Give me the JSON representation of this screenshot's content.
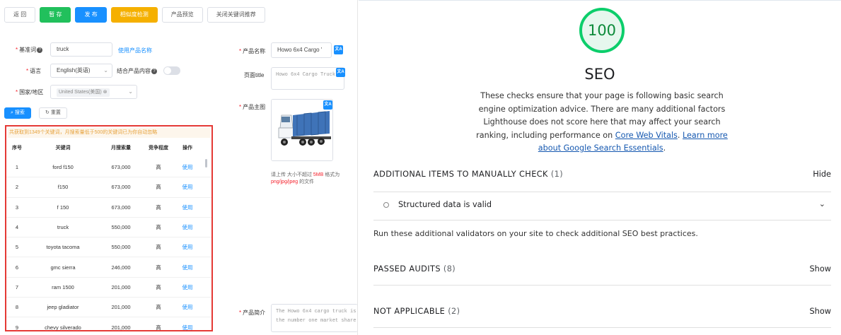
{
  "editor": {
    "toolbar": {
      "back": "返 回",
      "save_draft": "暂 存",
      "publish": "发 布",
      "similarity_check": "相似度检测",
      "preview": "产品预览",
      "close_keyword_recommend": "关闭关键词推荐"
    },
    "keyword_form": {
      "base_word_label": "基准词",
      "base_word_value": "truck",
      "use_product_name_link": "使用产品名称",
      "language_label": "语言",
      "language_value": "English(英语)",
      "combine_content_label": "结合产品内容",
      "country_label": "国家/地区",
      "country_value": "United States(美国)",
      "search_button": "搜索",
      "reset_button": "重置"
    },
    "keyword_table": {
      "notice": "共获取到1349个关键词，月搜索量低于500的关键词已为你自动忽略",
      "headers": [
        "序号",
        "关键词",
        "月搜索量",
        "竞争程度",
        "操作"
      ],
      "rows": [
        {
          "no": "1",
          "keyword": "ford f150",
          "volume": "673,000",
          "competition": "高",
          "action": "使用"
        },
        {
          "no": "2",
          "keyword": "f150",
          "volume": "673,000",
          "competition": "高",
          "action": "使用"
        },
        {
          "no": "3",
          "keyword": "f 150",
          "volume": "673,000",
          "competition": "高",
          "action": "使用"
        },
        {
          "no": "4",
          "keyword": "truck",
          "volume": "550,000",
          "competition": "高",
          "action": "使用"
        },
        {
          "no": "5",
          "keyword": "toyota tacoma",
          "volume": "550,000",
          "competition": "高",
          "action": "使用"
        },
        {
          "no": "6",
          "keyword": "gmc sierra",
          "volume": "246,000",
          "competition": "高",
          "action": "使用"
        },
        {
          "no": "7",
          "keyword": "ram 1500",
          "volume": "201,000",
          "competition": "高",
          "action": "使用"
        },
        {
          "no": "8",
          "keyword": "jeep gladiator",
          "volume": "201,000",
          "competition": "高",
          "action": "使用"
        },
        {
          "no": "9",
          "keyword": "chevy silverado",
          "volume": "201,000",
          "competition": "高",
          "action": "使用"
        }
      ]
    },
    "product_form": {
      "product_name_label": "产品名称",
      "product_name_value": "Howo 6x4 Cargo '",
      "page_title_label": "页面title",
      "page_title_value": "Howo 6x4 Cargo Truck",
      "main_image_label": "产品主图",
      "upload_tip_prefix": "请上传 大小不超过 ",
      "upload_tip_size": "5MB",
      "upload_tip_mid": " 格式为",
      "upload_tip_formats": "png/jpg/jpeg",
      "upload_tip_suffix": " 的文件",
      "summary_label": "产品简介",
      "summary_line1": "The Howo 6x4 cargo truck is",
      "summary_line2": "the number one market share"
    }
  },
  "lighthouse": {
    "score": "100",
    "score_color": "#0cce6b",
    "category_title": "SEO",
    "description_text": "These checks ensure that your page is following basic search engine optimization advice. There are many additional factors Lighthouse does not score here that may affect your search ranking, including performance on ",
    "cwv_link": "Core Web Vitals",
    "after_link": ". ",
    "learn_more_link": "Learn more about Google Search Essentials",
    "end_period": ".",
    "manual_group": {
      "title": "ADDITIONAL ITEMS TO MANUALLY CHECK",
      "count": "(1)",
      "toggle": "Hide"
    },
    "manual_item": "Structured data is valid",
    "validators_text": "Run these additional validators on your site to check additional SEO best practices.",
    "passed_group": {
      "title": "PASSED AUDITS",
      "count": "(8)",
      "toggle": "Show"
    },
    "na_group": {
      "title": "NOT APPLICABLE",
      "count": "(2)",
      "toggle": "Show"
    }
  }
}
